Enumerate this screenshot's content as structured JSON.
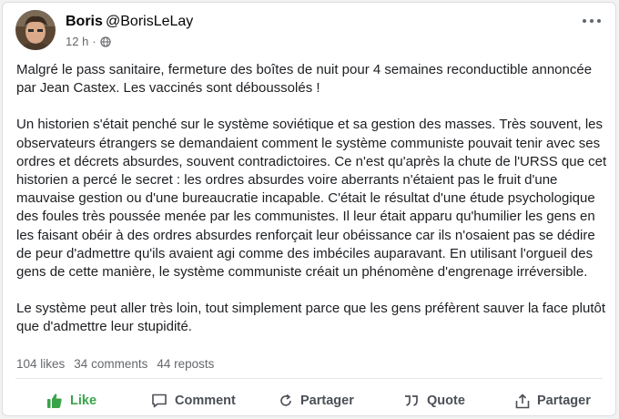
{
  "post": {
    "author_name": "Boris",
    "author_handle": "@BorisLeLay",
    "time": "12 h",
    "separator": "·",
    "paragraphs": [
      "Malgré le pass sanitaire, fermeture des boîtes de nuit pour 4 semaines reconductible annoncée par Jean Castex. Les vaccinés sont déboussolés !",
      "Un historien s'était penché sur le système soviétique et sa gestion des masses. Très souvent, les observateurs étrangers se demandaient comment le système communiste pouvait tenir avec ses ordres et décrets absurdes, souvent contradictoires. Ce n'est qu'après la chute de l'URSS que cet historien a percé le secret : les ordres absurdes voire aberrants n'étaient pas le fruit d'une mauvaise gestion ou d'une bureaucratie incapable. C'était le résultat d'une étude psychologique des foules très poussée menée par les communistes. Il leur était apparu qu'humilier les gens en les faisant obéir à des ordres absurdes renforçait leur obéissance car ils n'osaient pas se dédire de peur d'admettre qu'ils avaient agi comme des imbéciles auparavant. En utilisant l'orgueil des gens de cette manière, le système communiste créait un phénomène d'engrenage irréversible.",
      "Le système peut aller très loin, tout simplement parce que les gens préfèrent sauver la face plutôt que d'admettre leur stupidité."
    ]
  },
  "stats": {
    "likes": "104 likes",
    "comments": "34 comments",
    "reposts": "44 reposts"
  },
  "actions": {
    "like": "Like",
    "comment": "Comment",
    "repost": "Partager",
    "quote": "Quote",
    "share": "Partager"
  },
  "icons": {
    "like": "thumbs-up-icon",
    "comment": "comment-bubble-icon",
    "repost": "repost-arrow-icon",
    "quote": "quote-marks-icon",
    "share": "share-upload-icon",
    "visibility": "globe-icon",
    "more": "more-dots-icon"
  },
  "colors": {
    "like_accent": "#3aa34a",
    "text": "#1c1e21",
    "muted": "#65676b"
  }
}
